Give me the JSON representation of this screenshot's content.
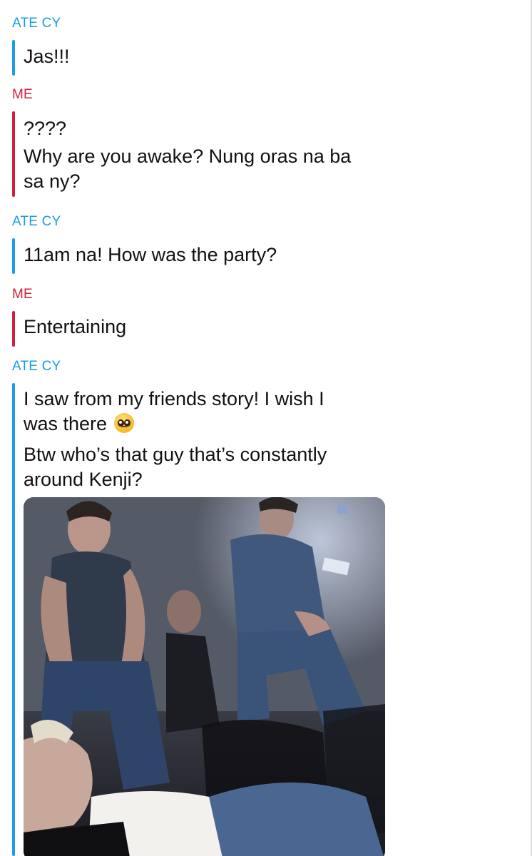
{
  "chat": {
    "contact_name": "ATE CY",
    "me_name": "ME",
    "colors": {
      "contact_accent": "#1c9be6",
      "me_accent": "#d0203f",
      "text": "#111111"
    },
    "messages": [
      {
        "sender": "ATE CY",
        "lines": [
          "Jas!!!"
        ]
      },
      {
        "sender": "ME",
        "lines": [
          "????",
          "Why are you awake? Nung oras na ba\nsa ny?"
        ]
      },
      {
        "sender": "ATE CY",
        "lines": [
          "11am na! How was the party?"
        ]
      },
      {
        "sender": "ME",
        "lines": [
          "Entertaining"
        ]
      },
      {
        "sender": "ATE CY",
        "lines": [
          "I saw from my friends story! I wish I\nwas there",
          "Btw who’s that guy that’s constantly\naround Kenji?"
        ],
        "emoji": "pleading-face-emoji",
        "attachment": "photo"
      }
    ]
  }
}
